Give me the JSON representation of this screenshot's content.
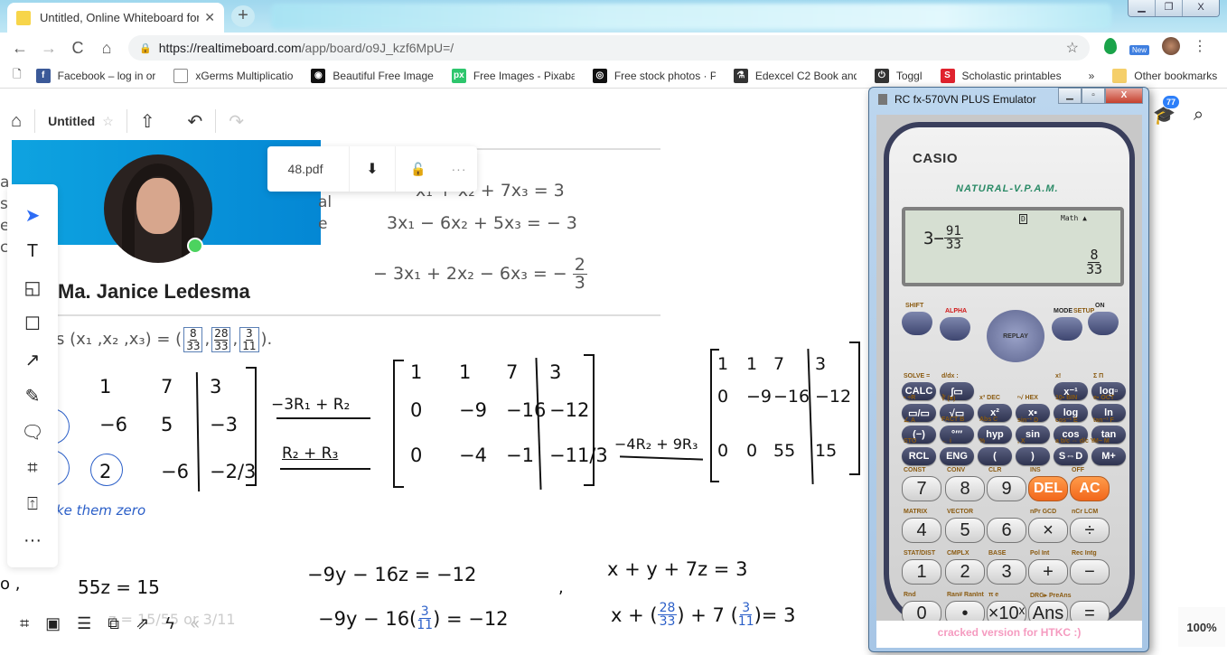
{
  "browser": {
    "tab_title": "Untitled, Online Whiteboard for Visual Collaboration",
    "tab_close": "✕",
    "new_tab": "+",
    "url_host": "https://realtimeboard.com",
    "url_path": "/app/board/o9J_kzf6MpU=/",
    "nav": {
      "back": "←",
      "forward": "→",
      "reload": "C",
      "home": "⌂"
    },
    "bookmark_star": "☆",
    "extensions": {
      "new_badge": "New",
      "menu": "⋮"
    },
    "window_controls": {
      "minimize": "▁",
      "maximize": "❐",
      "close": "X"
    },
    "bookmarks": [
      {
        "label": "Facebook – log in or",
        "icon": "facebook-icon",
        "glyph": "f",
        "color": "#3b5998"
      },
      {
        "label": "xGerms Multiplicatio",
        "icon": "page-icon",
        "glyph": "",
        "color": "#ffffff"
      },
      {
        "label": "Beautiful Free Image",
        "icon": "camera-icon",
        "glyph": "◉",
        "color": "#111111"
      },
      {
        "label": "Free Images - Pixaba",
        "icon": "pixabay-icon",
        "glyph": "px",
        "color": "#2ec66d"
      },
      {
        "label": "Free stock photos · P",
        "icon": "instagram-icon",
        "glyph": "◎",
        "color": "#111111"
      },
      {
        "label": "Edexcel C2 Book and",
        "icon": "flask-icon",
        "glyph": "⚗",
        "color": "#333333"
      },
      {
        "label": "Toggl",
        "icon": "power-icon",
        "glyph": "⏻",
        "color": "#333333"
      },
      {
        "label": "Scholastic printables",
        "icon": "scholastic-icon",
        "glyph": "S",
        "color": "#e0232e"
      }
    ],
    "bookmarks_overflow": "»",
    "other_bookmarks": "Other bookmarks"
  },
  "board": {
    "topbar": {
      "home": "⌂",
      "title": "Untitled",
      "star": "☆",
      "share": "⇧",
      "undo": "↶",
      "redo": "↷"
    },
    "notifications_count": "77",
    "zoom_level": "100%",
    "profile": {
      "name": "Ma. Janice Ledesma",
      "status": "online"
    },
    "pdf_toolbar": {
      "filename": "48.pdf",
      "download": "⬇",
      "lock": "🔓",
      "more": "···"
    },
    "left_tools": [
      {
        "name": "select-tool",
        "glyph": "➤"
      },
      {
        "name": "text-tool",
        "glyph": "T"
      },
      {
        "name": "sticky-note-tool",
        "glyph": "◱"
      },
      {
        "name": "shape-tool",
        "glyph": "☐"
      },
      {
        "name": "arrow-tool",
        "glyph": "↗"
      },
      {
        "name": "pen-tool",
        "glyph": "✎"
      },
      {
        "name": "comment-tool",
        "glyph": "🗨"
      },
      {
        "name": "frame-tool",
        "glyph": "⌗"
      },
      {
        "name": "upload-tool",
        "glyph": "⍐"
      },
      {
        "name": "more-tools",
        "glyph": "···"
      }
    ],
    "bottom_tools": [
      {
        "name": "frames-icon",
        "glyph": "⌗"
      },
      {
        "name": "presentation-icon",
        "glyph": "▣"
      },
      {
        "name": "comments-icon",
        "glyph": "☰"
      },
      {
        "name": "screen-share-icon",
        "glyph": "⧉"
      },
      {
        "name": "export-icon",
        "glyph": "⇗"
      },
      {
        "name": "lightning-icon",
        "glyph": "ϟ"
      },
      {
        "name": "collapse-icon",
        "glyph": "«"
      }
    ],
    "doc": {
      "cut_left": [
        "a",
        "s",
        "e",
        "c"
      ],
      "cut_right": [
        "al",
        "e"
      ],
      "eq1": "x₁ + x₂ + 7x₃  =  3",
      "eq2_lhs": "3x",
      "eq2": "3x₁ − 6x₂ + 5x₃  =  − 3",
      "eq3": "− 3x₁ + 2x₂ − 6x₃  =  −",
      "eq3_frac": {
        "n": "2",
        "d": "3"
      },
      "solution_prefix": "s (x₁ ,x₂ ,x₃) = (",
      "solution_fracs": [
        {
          "n": "8",
          "d": "33"
        },
        {
          "n": "28",
          "d": "33"
        },
        {
          "n": "3",
          "d": "11"
        }
      ],
      "solution_suffix": ")."
    },
    "handwriting": {
      "m1_rows": [
        [
          "1",
          "7",
          "3"
        ],
        [
          "−6",
          "5",
          "−3"
        ],
        [
          "2",
          "−6",
          "−2/3"
        ]
      ],
      "op1": "−3R₁ + R₂",
      "op2": "R₂ + R₃",
      "m2_rows": [
        [
          "1",
          "1",
          "7",
          "3"
        ],
        [
          "0",
          "−9",
          "−16",
          "−12"
        ],
        [
          "0",
          "−4",
          "−1",
          "−11/3"
        ]
      ],
      "op3": "−4R₂ + 9R₃",
      "m3_rows": [
        [
          "1",
          "1",
          "7",
          "3"
        ],
        [
          "0",
          "−9",
          "−16",
          "−12"
        ],
        [
          "0",
          "0",
          "55",
          "15"
        ]
      ],
      "note": "ke them zero",
      "line_a_prefix": "o ,",
      "eq_z": "55z =  15",
      "eq_z_solved": "z = 15/55 or 3/11",
      "eq_y1": "−9y − 16z  = −12",
      "eq_y2_pre": "−9y − 16(",
      "eq_y2_frac": {
        "n": "3",
        "d": "11"
      },
      "eq_y2_post": ") = −12",
      "comma": ",",
      "eq_x1": "x + y + 7z = 3",
      "eq_x2_pre": "x + (",
      "eq_x2_frac1": {
        "n": "28",
        "d": "33"
      },
      "eq_x2_mid": ") + 7 (",
      "eq_x2_frac2": {
        "n": "3",
        "d": "11"
      },
      "eq_x2_post": ")= 3"
    }
  },
  "calculator": {
    "window_title": "RC fx-570VN PLUS Emulator",
    "brand": "CASIO",
    "model_tag": "NATURAL-V.P.A.M.",
    "display": {
      "indicator_d": "D",
      "indicator_mode": "Math ▲",
      "expr_int": "3−",
      "expr_frac": {
        "n": "91",
        "d": "33"
      },
      "result_frac": {
        "n": "8",
        "d": "33"
      }
    },
    "top_labels": {
      "shift": "SHIFT",
      "alpha": "ALPHA",
      "mode": "MODE",
      "setup": "SETUP",
      "on": "ON",
      "replay": "REPLAY"
    },
    "func_rows": [
      [
        {
          "key": "CALC",
          "top": "SOLVE ="
        },
        {
          "key": "∫▭",
          "top": "d/dx :"
        },
        {
          "key": "x⁻¹",
          "top": "x!"
        },
        {
          "key": "log▫",
          "top": "Σ Π"
        }
      ],
      [
        {
          "key": "▭/▭",
          "top": "▪ ÷R"
        },
        {
          "key": "√▭",
          "top": "∛ (■)"
        },
        {
          "key": "x²",
          "top": "x³ DEC"
        },
        {
          "key": "x▪",
          "top": "ⁿ√ HEX"
        },
        {
          "key": "log",
          "top": "10▪ BIN"
        },
        {
          "key": "ln",
          "top": "e▪ OCT"
        }
      ],
      [
        {
          "key": "(−)",
          "top": "∠ A"
        },
        {
          "key": "°′″",
          "top": "FACT B"
        },
        {
          "key": "hyp",
          "top": "Abs C"
        },
        {
          "key": "sin",
          "top": "sin⁻¹ D"
        },
        {
          "key": "cos",
          "top": "cos⁻¹ E"
        },
        {
          "key": "tan",
          "top": "tan⁻¹ F"
        }
      ],
      [
        {
          "key": "RCL",
          "top": "STO"
        },
        {
          "key": "ENG",
          "top": "← i"
        },
        {
          "key": "(",
          "top": "%"
        },
        {
          "key": ")",
          "top": ", X"
        },
        {
          "key": "S⇔D",
          "top": "a b/c ⇔ d/c Y"
        },
        {
          "key": "M+",
          "top": "M− M"
        }
      ]
    ],
    "num_rows": [
      [
        {
          "key": "7",
          "top": "CONST"
        },
        {
          "key": "8",
          "top": "CONV"
        },
        {
          "key": "9",
          "top": "CLR"
        },
        {
          "key": "DEL",
          "top": "INS",
          "orange": true
        },
        {
          "key": "AC",
          "top": "OFF",
          "orange": true
        }
      ],
      [
        {
          "key": "4",
          "top": "MATRIX"
        },
        {
          "key": "5",
          "top": "VECTOR"
        },
        {
          "key": "6",
          "top": ""
        },
        {
          "key": "×",
          "top": "nPr GCD"
        },
        {
          "key": "÷",
          "top": "nCr LCM"
        }
      ],
      [
        {
          "key": "1",
          "top": "STAT/DIST"
        },
        {
          "key": "2",
          "top": "CMPLX"
        },
        {
          "key": "3",
          "top": "BASE"
        },
        {
          "key": "+",
          "top": "Pol Int"
        },
        {
          "key": "−",
          "top": "Rec Intg"
        }
      ],
      [
        {
          "key": "0",
          "top": "Rnd"
        },
        {
          "key": "•",
          "top": "Ran# RanInt"
        },
        {
          "key": "×10ˣ",
          "top": "π e"
        },
        {
          "key": "Ans",
          "top": "DRG▸ PreAns"
        },
        {
          "key": "=",
          "top": ""
        }
      ]
    ],
    "footer": "cracked version for HTKC :)"
  }
}
